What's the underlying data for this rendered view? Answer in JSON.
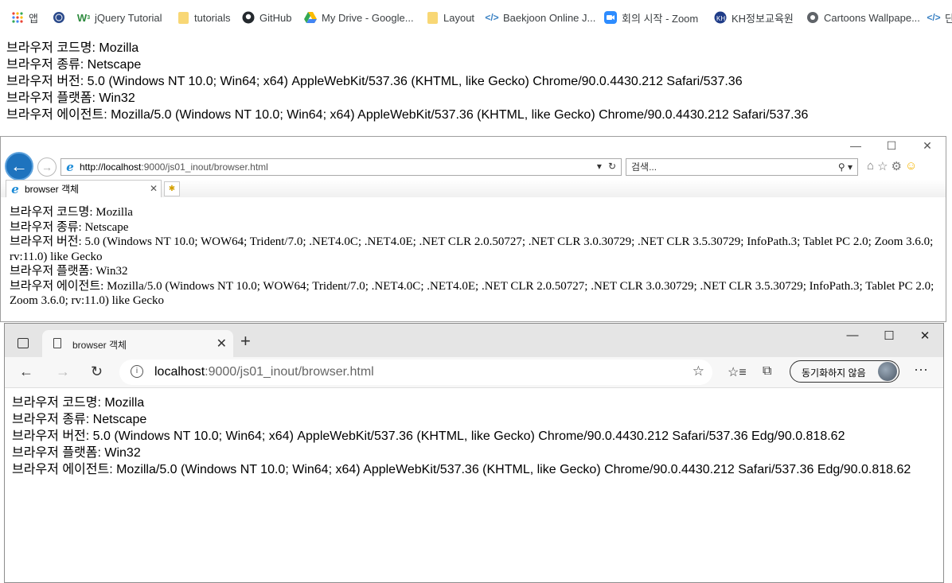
{
  "bookmarks": [
    {
      "label": "앱",
      "icon": "apps-grid-icon"
    },
    {
      "label": "",
      "icon": "globe-emblem-icon"
    },
    {
      "label": "jQuery Tutorial",
      "icon": "w3-icon"
    },
    {
      "label": "tutorials",
      "icon": "folder-icon"
    },
    {
      "label": "GitHub",
      "icon": "github-icon"
    },
    {
      "label": "My Drive - Google...",
      "icon": "drive-icon"
    },
    {
      "label": "Layout",
      "icon": "folder-icon"
    },
    {
      "label": "Baekjoon Online J...",
      "icon": "code-icon"
    },
    {
      "label": "회의 시작 - Zoom",
      "icon": "zoom-icon"
    },
    {
      "label": "KH정보교육원",
      "icon": "kh-icon"
    },
    {
      "label": "Cartoons Wallpape...",
      "icon": "globe-icon"
    },
    {
      "label": "단",
      "icon": "code-icon"
    }
  ],
  "chrome_page": {
    "lines": [
      "브라우저 코드명: Mozilla",
      "브라우저 종류: Netscape",
      "브라우저 버전: 5.0 (Windows NT 10.0; Win64; x64) AppleWebKit/537.36 (KHTML, like Gecko) Chrome/90.0.4430.212 Safari/537.36",
      "브라우저 플랫폼: Win32",
      "브라우저 에이전트: Mozilla/5.0 (Windows NT 10.0; Win64; x64) AppleWebKit/537.36 (KHTML, like Gecko) Chrome/90.0.4430.212 Safari/537.36"
    ]
  },
  "ie": {
    "url_host": "http://localhost",
    "url_rest": ":9000/js01_inout/browser.html",
    "search_placeholder": "검색...",
    "tab_title": "browser 객체",
    "lines": [
      "브라우저 코드명: Mozilla",
      "브라우저 종류: Netscape",
      "브라우저 버전: 5.0 (Windows NT 10.0; WOW64; Trident/7.0; .NET4.0C; .NET4.0E; .NET CLR 2.0.50727; .NET CLR 3.0.30729; .NET CLR 3.5.30729; InfoPath.3; Tablet PC 2.0; Zoom 3.6.0; rv:11.0) like Gecko",
      "브라우저 플랫폼: Win32",
      "브라우저 에이전트: Mozilla/5.0 (Windows NT 10.0; WOW64; Trident/7.0; .NET4.0C; .NET4.0E; .NET CLR 2.0.50727; .NET CLR 3.0.30729; .NET CLR 3.5.30729; InfoPath.3; Tablet PC 2.0; Zoom 3.6.0; rv:11.0) like Gecko"
    ]
  },
  "edge": {
    "tab_title": "browser 객체",
    "url_host": "localhost",
    "url_rest": ":9000/js01_inout/browser.html",
    "sync_label": "동기화하지 않음",
    "lines": [
      "브라우저 코드명: Mozilla",
      "브라우저 종류: Netscape",
      "브라우저 버전: 5.0 (Windows NT 10.0; Win64; x64) AppleWebKit/537.36 (KHTML, like Gecko) Chrome/90.0.4430.212 Safari/537.36 Edg/90.0.818.62",
      "브라우저 플랫폼: Win32",
      "브라우저 에이전트: Mozilla/5.0 (Windows NT 10.0; Win64; x64) AppleWebKit/537.36 (KHTML, like Gecko) Chrome/90.0.4430.212 Safari/537.36 Edg/90.0.818.62"
    ]
  }
}
